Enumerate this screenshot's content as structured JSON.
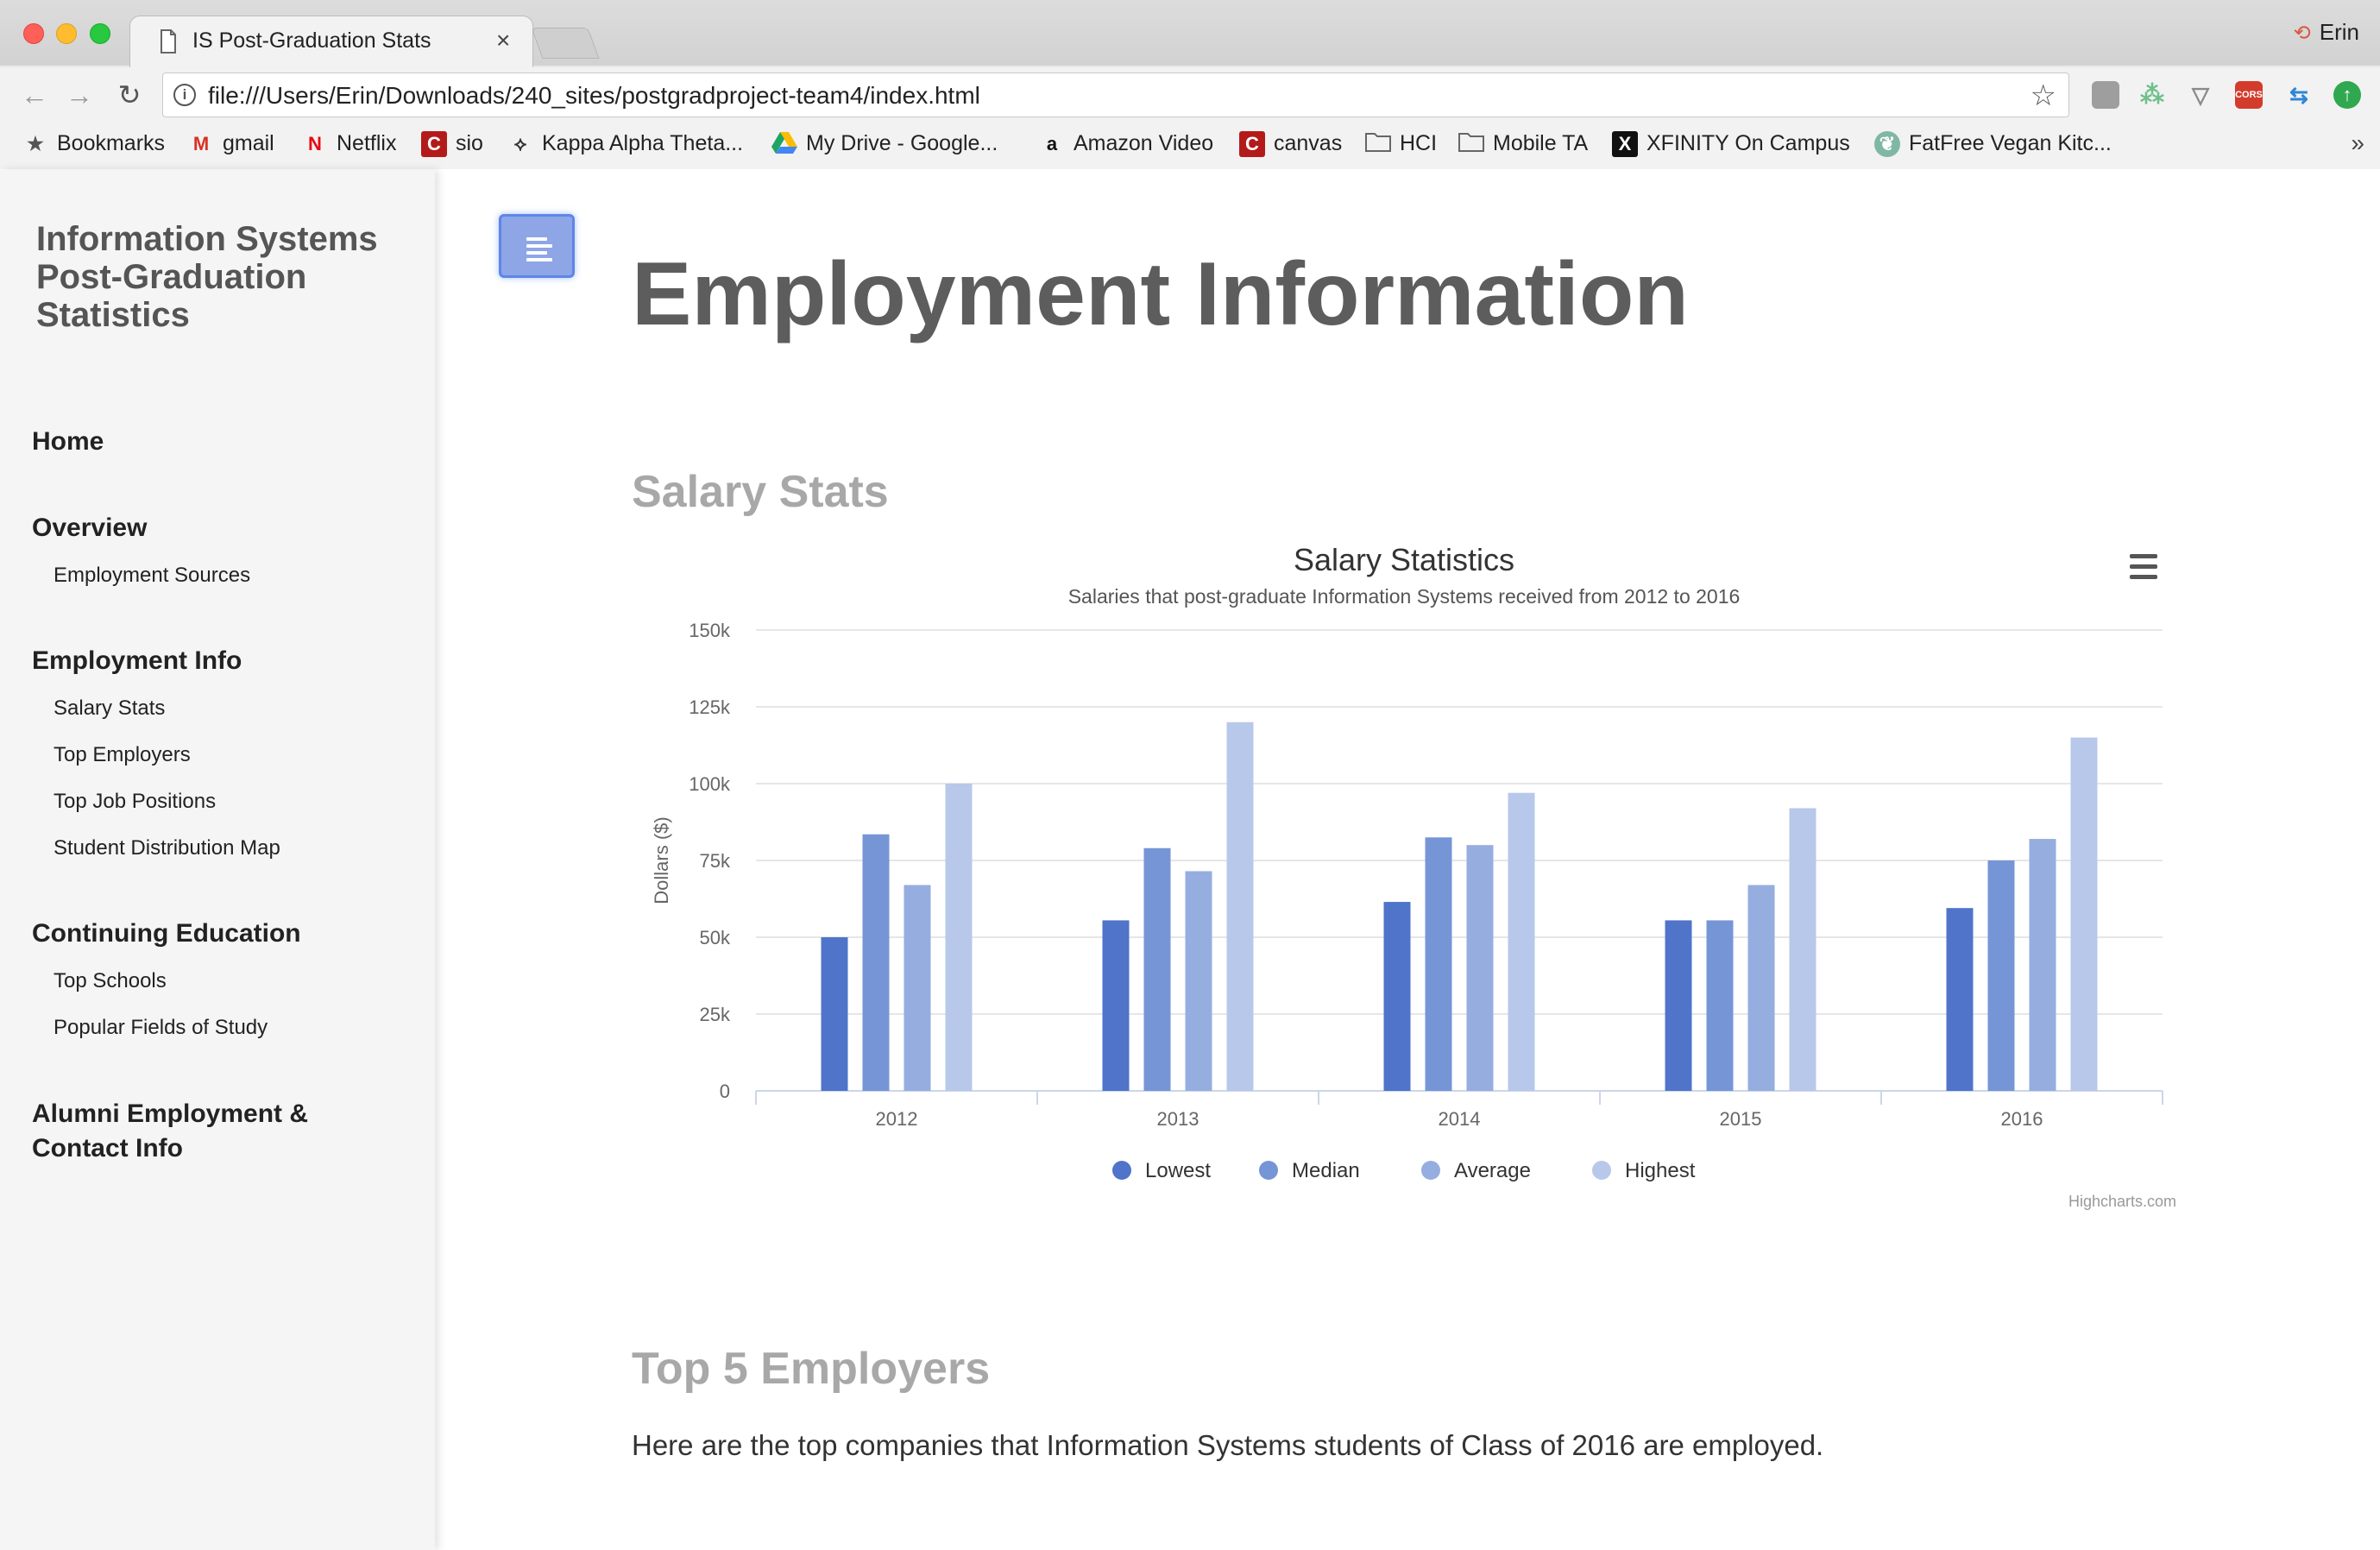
{
  "browser": {
    "tab_title": "IS Post-Graduation Stats",
    "tab_close": "×",
    "profile_name": "Erin",
    "url": "file:///Users/Erin/Downloads/240_sites/postgradproject-team4/index.html",
    "bookmarks": [
      {
        "label": "Bookmarks",
        "icon": "star-icon"
      },
      {
        "label": "gmail",
        "icon": "gmail-icon"
      },
      {
        "label": "Netflix",
        "icon": "netflix-icon"
      },
      {
        "label": "sio",
        "icon": "cornell-icon"
      },
      {
        "label": "Kappa Alpha Theta...",
        "icon": "kite-icon"
      },
      {
        "label": "My Drive - Google...",
        "icon": "google-drive-icon"
      },
      {
        "label": "Amazon Video",
        "icon": "amazon-icon"
      },
      {
        "label": "canvas",
        "icon": "cornell-icon"
      },
      {
        "label": "HCI",
        "icon": "folder-icon"
      },
      {
        "label": "Mobile TA",
        "icon": "folder-icon"
      },
      {
        "label": "XFINITY On Campus",
        "icon": "xfinity-icon"
      },
      {
        "label": "FatFree Vegan Kitc...",
        "icon": "leaf-icon"
      }
    ],
    "ext_cors_label": "CORS"
  },
  "sidebar": {
    "title": "Information Systems Post-Graduation Statistics",
    "sections": [
      {
        "label": "Home",
        "items": []
      },
      {
        "label": "Overview",
        "items": [
          "Employment Sources"
        ]
      },
      {
        "label": "Employment Info",
        "items": [
          "Salary Stats",
          "Top Employers",
          "Top Job Positions",
          "Student Distribution Map"
        ]
      },
      {
        "label": "Continuing Education",
        "items": [
          "Top Schools",
          "Popular Fields of Study"
        ]
      },
      {
        "label": "Alumni Employment & Contact Info",
        "items": []
      }
    ]
  },
  "main": {
    "page_title": "Employment Information",
    "salary_heading": "Salary Stats",
    "employers_heading": "Top 5 Employers",
    "employers_text": "Here are the top companies that Information Systems students of Class of 2016 are employed."
  },
  "chart_data": {
    "type": "bar",
    "title": "Salary Statistics",
    "subtitle": "Salaries that post-graduate Information Systems received from 2012 to 2016",
    "xlabel": "",
    "ylabel": "Dollars ($)",
    "categories": [
      "2012",
      "2013",
      "2014",
      "2015",
      "2016"
    ],
    "ylim": [
      0,
      150000
    ],
    "yticks": [
      0,
      25000,
      50000,
      75000,
      100000,
      125000,
      150000
    ],
    "ytick_labels": [
      "0",
      "25k",
      "50k",
      "75k",
      "100k",
      "125k",
      "150k"
    ],
    "grid": true,
    "legend_position": "bottom-center",
    "series": [
      {
        "name": "Lowest",
        "color": "#4f74c9",
        "values": [
          50000,
          55500,
          61500,
          55500,
          59500
        ]
      },
      {
        "name": "Median",
        "color": "#7595d6",
        "values": [
          83500,
          79000,
          82500,
          55500,
          75000
        ]
      },
      {
        "name": "Average",
        "color": "#96ade0",
        "values": [
          67000,
          71500,
          80000,
          67000,
          82000
        ]
      },
      {
        "name": "Highest",
        "color": "#b8c8ea",
        "values": [
          100000,
          120000,
          97000,
          92000,
          115000
        ]
      }
    ],
    "credit": "Highcharts.com"
  }
}
